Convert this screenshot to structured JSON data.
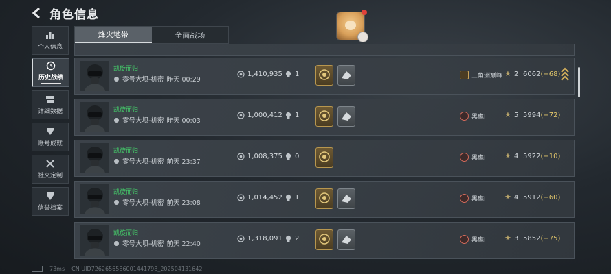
{
  "header": {
    "title": "角色信息"
  },
  "sidebar": {
    "items": [
      {
        "label": "个人信息",
        "icon": "bar-chart-icon"
      },
      {
        "label": "历史战绩",
        "icon": "history-icon",
        "active": true
      },
      {
        "label": "详细数据",
        "icon": "data-icon"
      },
      {
        "label": "账号成就",
        "icon": "trophy-icon"
      },
      {
        "label": "社交定制",
        "icon": "tools-icon"
      },
      {
        "label": "信誉档案",
        "icon": "shield-icon"
      }
    ]
  },
  "tabs": [
    {
      "label": "烽火地带",
      "active": true
    },
    {
      "label": "全面战场",
      "active": false
    }
  ],
  "matches": [
    {
      "result": "凯旋而归",
      "map": "零号大坝-机密",
      "time": "昨天 00:29",
      "money": "1,410,935",
      "kills": "1",
      "badges": 2,
      "rank": "三角洲巅峰",
      "rank_type": "gold",
      "stars": "2",
      "score": "6062",
      "delta": "(+68)",
      "chevron": true
    },
    {
      "result": "凯旋而归",
      "map": "零号大坝-机密",
      "time": "昨天 00:03",
      "money": "1,000,412",
      "kills": "1",
      "badges": 2,
      "rank": "黑鹰I",
      "rank_type": "red",
      "stars": "5",
      "score": "5994",
      "delta": "(+72)",
      "chevron": false
    },
    {
      "result": "凯旋而归",
      "map": "零号大坝-机密",
      "time": "前天 23:37",
      "money": "1,008,375",
      "kills": "0",
      "badges": 1,
      "rank": "黑鹰I",
      "rank_type": "red",
      "stars": "4",
      "score": "5922",
      "delta": "(+10)",
      "chevron": false
    },
    {
      "result": "凯旋而归",
      "map": "零号大坝-机密",
      "time": "前天 23:08",
      "money": "1,014,452",
      "kills": "1",
      "badges": 2,
      "rank": "黑鹰I",
      "rank_type": "red",
      "stars": "4",
      "score": "5912",
      "delta": "(+60)",
      "chevron": false
    },
    {
      "result": "凯旋而归",
      "map": "零号大坝-机密",
      "time": "前天 22:40",
      "money": "1,318,091",
      "kills": "2",
      "badges": 2,
      "rank": "黑鹰I",
      "rank_type": "red",
      "stars": "3",
      "score": "5852",
      "delta": "(+75)",
      "chevron": false
    }
  ],
  "footer": {
    "ping": "73ms",
    "uid": "CN UID7262656586001441798_202504131642"
  },
  "colors": {
    "result_green": "#45d16b",
    "delta_gold": "#e0c56a",
    "accent": "#d7dbde"
  }
}
